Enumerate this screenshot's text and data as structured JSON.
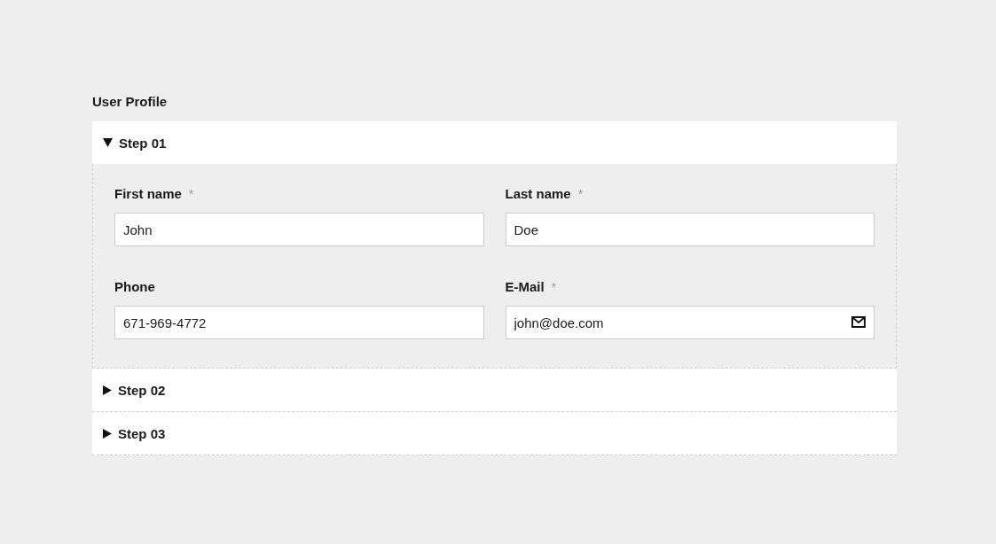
{
  "title": "User Profile",
  "steps": [
    {
      "label": "Step 01",
      "expanded": true,
      "fields": [
        {
          "label": "First name",
          "required_mark": "*",
          "kind": "text",
          "value": "John"
        },
        {
          "label": "Last name",
          "required_mark": "*",
          "kind": "text",
          "value": "Doe"
        },
        {
          "label": "Phone",
          "kind": "text",
          "value": "671-969-4772"
        },
        {
          "label": "E-Mail",
          "required_mark": "*",
          "kind": "email",
          "value": "john@doe.com"
        }
      ]
    },
    {
      "label": "Step 02",
      "expanded": false
    },
    {
      "label": "Step 03",
      "expanded": false
    }
  ]
}
